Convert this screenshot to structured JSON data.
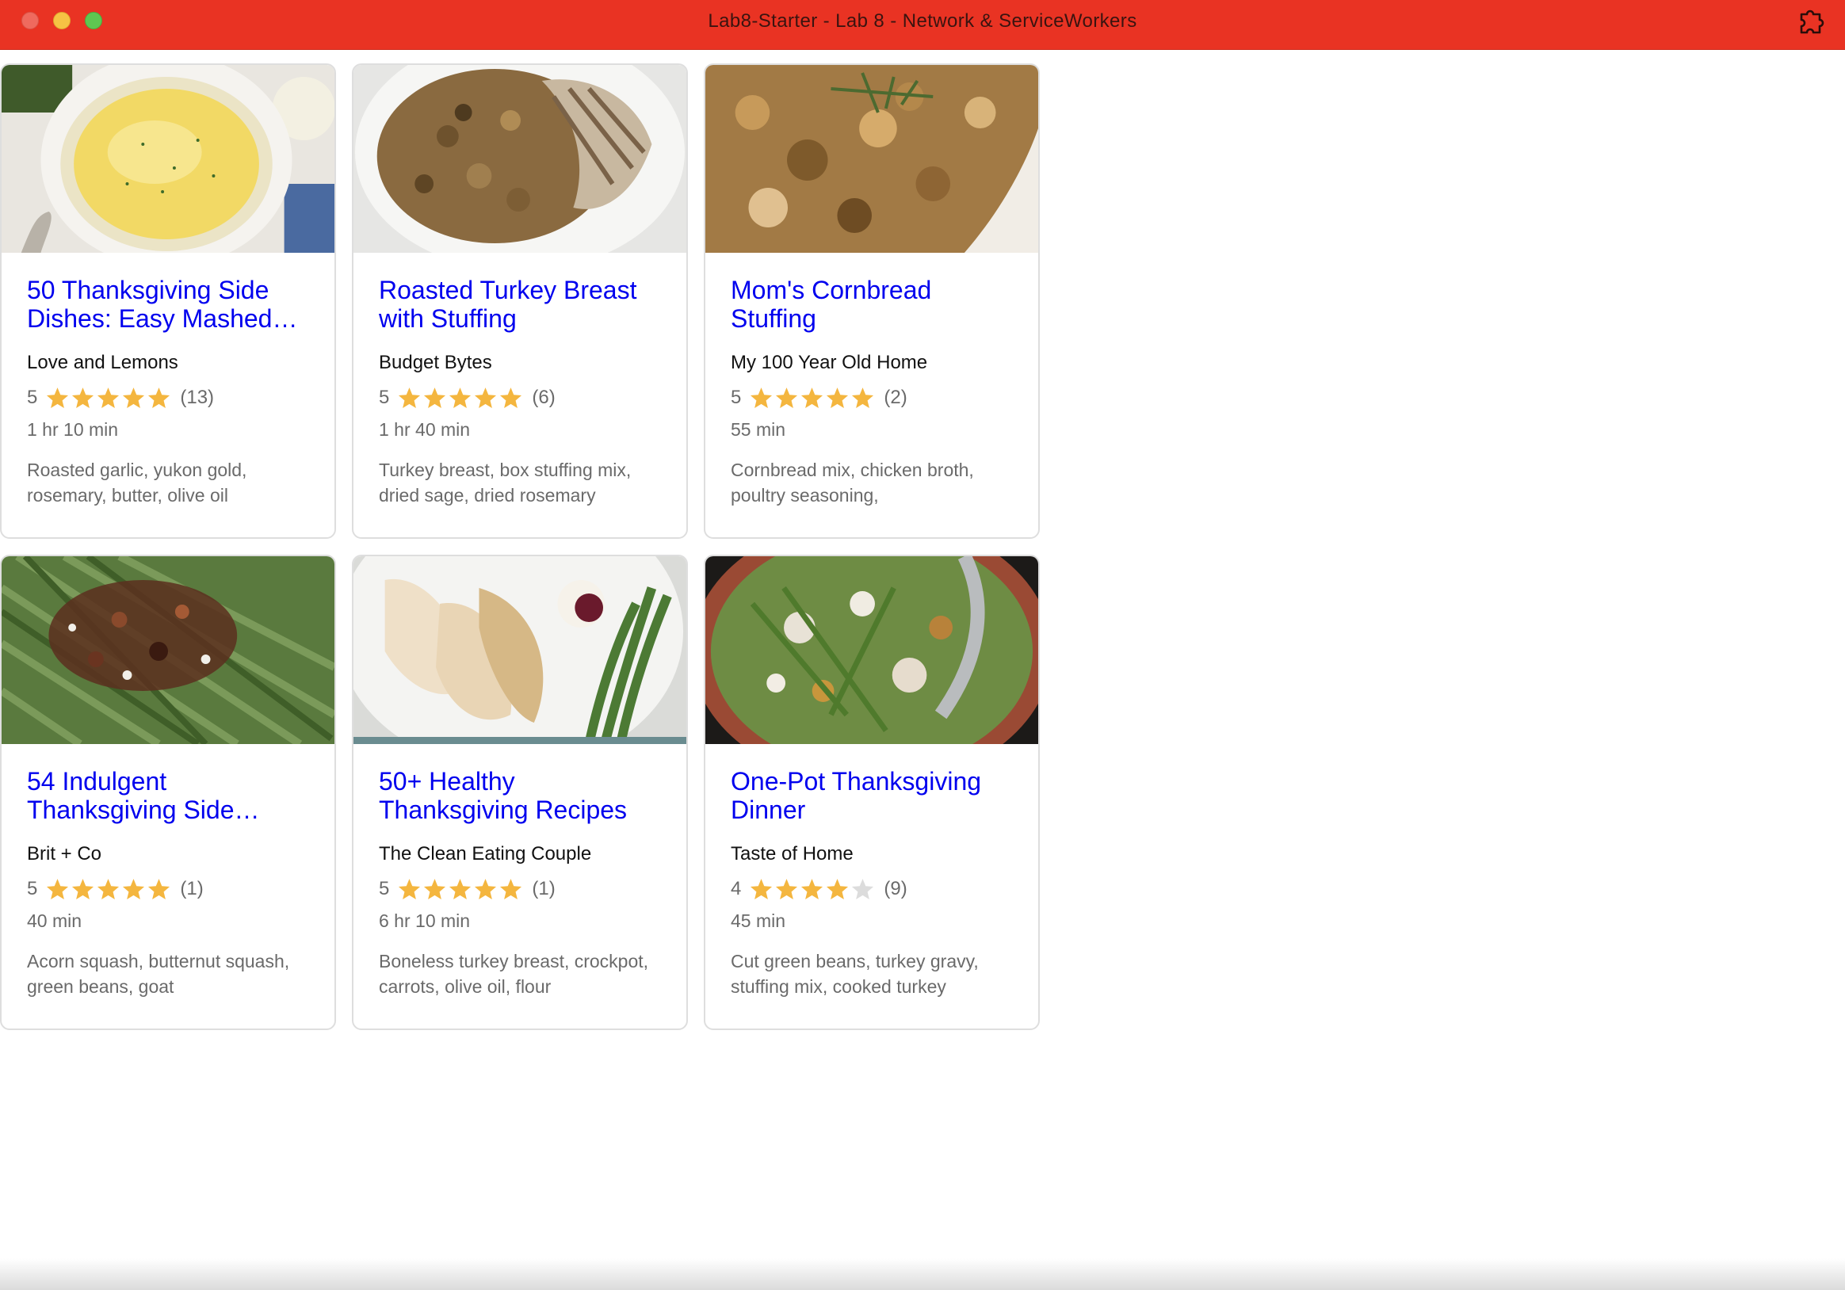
{
  "window": {
    "title": "Lab8-Starter - Lab 8 - Network & ServiceWorkers"
  },
  "colors": {
    "titlebar": "#e93323",
    "link": "#0000ee",
    "star_filled": "#f4b63f",
    "star_empty": "#dcdcdc"
  },
  "recipes": [
    {
      "title": "50 Thanksgiving Side Dishes: Easy Mashed…",
      "organization": "Love and Lemons",
      "rating": "5",
      "rating_value": 5,
      "reviews": "(13)",
      "time": "1 hr 10 min",
      "ingredients": "Roasted garlic, yukon gold, rosemary, butter, olive oil",
      "image_icon": "mashed-potatoes-image"
    },
    {
      "title": "Roasted Turkey Breast with Stuffing",
      "organization": "Budget Bytes",
      "rating": "5",
      "rating_value": 5,
      "reviews": "(6)",
      "time": "1 hr 40 min",
      "ingredients": "Turkey breast, box stuffing mix, dried sage, dried rosemary",
      "image_icon": "turkey-stuffing-image"
    },
    {
      "title": "Mom's Cornbread Stuffing",
      "organization": "My 100 Year Old Home",
      "rating": "5",
      "rating_value": 5,
      "reviews": "(2)",
      "time": "55 min",
      "ingredients": "Cornbread mix, chicken broth, poultry seasoning,",
      "image_icon": "cornbread-stuffing-image"
    },
    {
      "title": "54 Indulgent Thanksgiving Side…",
      "organization": "Brit + Co",
      "rating": "5",
      "rating_value": 5,
      "reviews": "(1)",
      "time": "40 min",
      "ingredients": "Acorn squash, butternut squash, green beans, goat",
      "image_icon": "green-beans-pecans-image"
    },
    {
      "title": "50+ Healthy Thanksgiving Recipes",
      "organization": "The Clean Eating Couple",
      "rating": "5",
      "rating_value": 5,
      "reviews": "(1)",
      "time": "6 hr 10 min",
      "ingredients": "Boneless turkey breast, crockpot, carrots, olive oil, flour",
      "image_icon": "turkey-plate-image"
    },
    {
      "title": "One-Pot Thanksgiving Dinner",
      "organization": "Taste of Home",
      "rating": "4",
      "rating_value": 4,
      "reviews": "(9)",
      "time": "45 min",
      "ingredients": "Cut green beans, turkey gravy, stuffing mix, cooked turkey",
      "image_icon": "one-pot-dinner-image"
    }
  ]
}
